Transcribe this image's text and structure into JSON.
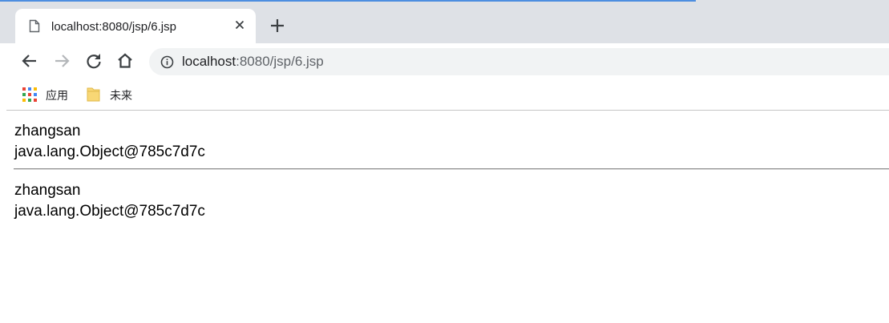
{
  "browser": {
    "tab": {
      "title": "localhost:8080/jsp/6.jsp",
      "page_icon": "page-icon",
      "close_icon": "close-icon"
    },
    "new_tab_icon": "plus-icon",
    "toolbar": {
      "back_icon": "back-arrow-icon",
      "forward_icon": "forward-arrow-icon",
      "reload_icon": "reload-icon",
      "home_icon": "home-icon",
      "url_host": "localhost",
      "url_rest": ":8080/jsp/6.jsp",
      "info_icon": "info-icon"
    },
    "bookmarks": [
      {
        "label": "应用",
        "icon": "apps-grid-icon"
      },
      {
        "label": "未来",
        "icon": "folder-icon"
      }
    ],
    "colors": {
      "tabstrip": "#dee1e6",
      "omnibox": "#f1f3f4",
      "accent": "#4d8ee0"
    }
  },
  "page": {
    "block1": {
      "line1": "zhangsan",
      "line2": "java.lang.Object@785c7d7c"
    },
    "block2": {
      "line1": "zhangsan",
      "line2": "java.lang.Object@785c7d7c"
    }
  }
}
